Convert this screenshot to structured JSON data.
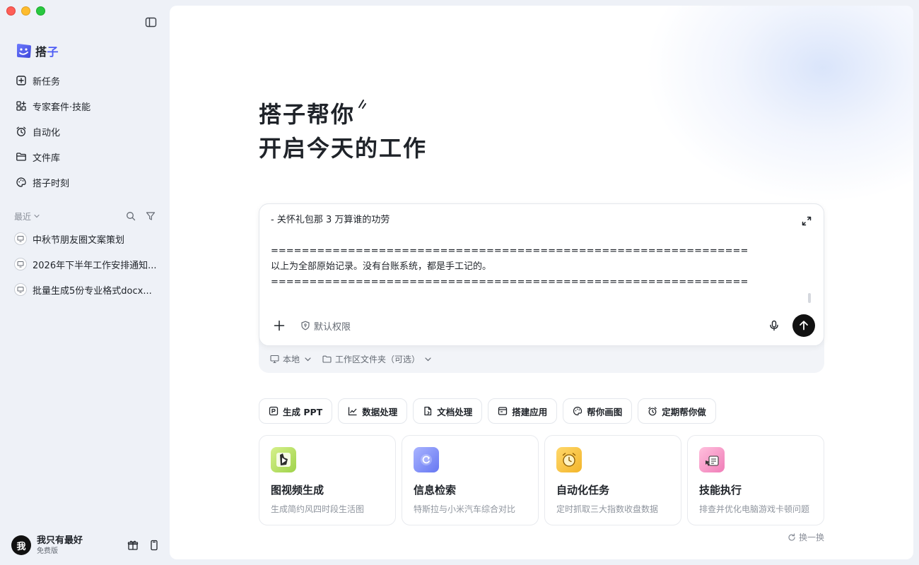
{
  "sidebar": {
    "logo_text": "搭",
    "logo_accent": "子",
    "nav": [
      {
        "label": "新任务",
        "icon": "new-task-icon"
      },
      {
        "label": "专家套件·技能",
        "icon": "grid-plus-icon"
      },
      {
        "label": "自动化",
        "icon": "alarm-clock-icon"
      },
      {
        "label": "文件库",
        "icon": "folder-icon"
      },
      {
        "label": "搭子时刻",
        "icon": "palette-icon"
      }
    ],
    "recent_label": "最近",
    "recent": [
      {
        "label": "中秋节朋友圈文案策划"
      },
      {
        "label": "2026年下半年工作安排通知..."
      },
      {
        "label": "批量生成5份专业格式docx..."
      }
    ],
    "user": {
      "avatar_text": "我",
      "name": "我只有最好",
      "plan": "免费版"
    }
  },
  "hero": {
    "line1": "搭子帮你",
    "line2": "开启今天的工作"
  },
  "composer": {
    "lines": [
      "- 关怀礼包那 3 万算谁的功劳",
      "",
      "==============================================================",
      "以上为全部原始记录。没有台账系统，都是手工记的。",
      "=============================================================="
    ],
    "permission_label": "默认权限",
    "location_label": "本地",
    "workspace_label": "工作区文件夹（可选）"
  },
  "chips": [
    {
      "label": "生成 PPT",
      "icon": "ppt-icon"
    },
    {
      "label": "数据处理",
      "icon": "line-chart-icon"
    },
    {
      "label": "文档处理",
      "icon": "document-icon"
    },
    {
      "label": "搭建应用",
      "icon": "app-window-icon"
    },
    {
      "label": "帮你画图",
      "icon": "palette-icon"
    },
    {
      "label": "定期帮你做",
      "icon": "alarm-clock-icon"
    }
  ],
  "cards": [
    {
      "title": "图视频生成",
      "desc": "生成简约风四时段生活图",
      "icon": "video-generation-icon",
      "color": "#b8e06a"
    },
    {
      "title": "信息检索",
      "desc": "特斯拉与小米汽车综合对比",
      "icon": "search-orb-icon",
      "color": "#7d8cf8"
    },
    {
      "title": "自动化任务",
      "desc": "定时抓取三大指数收盘数据",
      "icon": "alarm-clock-icon",
      "color": "#f6c64a"
    },
    {
      "title": "技能执行",
      "desc": "排查并优化电脑游戏卡顿问题",
      "icon": "skill-icon",
      "color": "#f59ac6"
    }
  ],
  "refresh_label": "换一换"
}
